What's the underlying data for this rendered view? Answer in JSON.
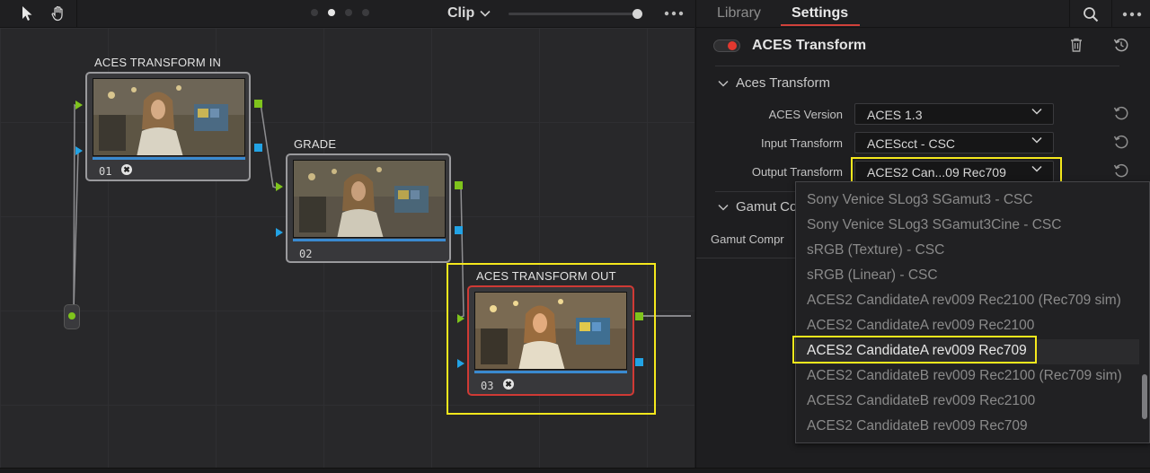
{
  "toolbar": {
    "pointer_icon": "arrow-pointer-icon",
    "hand_icon": "hand-pan-icon",
    "clip_label": "Clip",
    "more_icon": "ellipsis-icon"
  },
  "nodes": [
    {
      "title": "ACES TRANSFORM IN",
      "number": "01",
      "fx": "fx-badge-icon"
    },
    {
      "title": "GRADE",
      "number": "02"
    },
    {
      "title": "ACES TRANSFORM OUT",
      "number": "03",
      "fx": "fx-badge-icon"
    }
  ],
  "inspector": {
    "tabs": [
      "Library",
      "Settings"
    ],
    "active_tab": "Settings",
    "effect_title": "ACES Transform",
    "effect_enabled": true,
    "section_aces": "Aces Transform",
    "section_gamut": "Gamut Co",
    "params": [
      {
        "label": "ACES Version",
        "value": "ACES 1.3"
      },
      {
        "label": "Input Transform",
        "value": "ACEScct - CSC"
      },
      {
        "label": "Output Transform",
        "value": "ACES2 Can...09 Rec709"
      }
    ],
    "gamut_label": "Gamut Compr"
  },
  "menu": {
    "items": [
      "Sony Venice SLog3 SGamut3 - CSC",
      "Sony Venice SLog3 SGamut3Cine - CSC",
      "sRGB (Texture) - CSC",
      "sRGB (Linear) - CSC",
      "ACES2 CandidateA rev009 Rec2100 (Rec709 sim)",
      "ACES2 CandidateA rev009 Rec2100",
      "ACES2 CandidateA rev009 Rec709",
      "ACES2 CandidateB rev009 Rec2100 (Rec709 sim)",
      "ACES2 CandidateB rev009 Rec2100",
      "ACES2 CandidateB rev009 Rec709"
    ],
    "selected": "ACES2 CandidateA rev009 Rec709"
  },
  "colors": {
    "accent_red": "#e2382f",
    "highlight_yellow": "#f5e81c",
    "port_green": "#7fc41c",
    "port_blue": "#22a3e5"
  }
}
